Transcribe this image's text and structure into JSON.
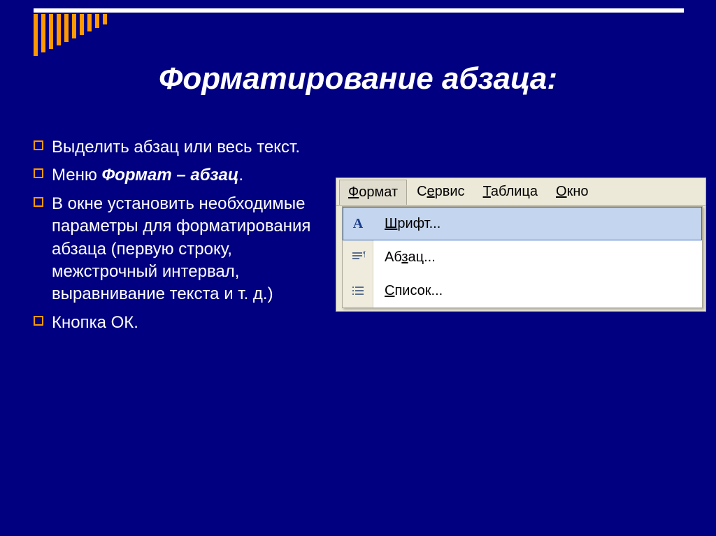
{
  "title": "Форматирование абзаца:",
  "bullets": [
    {
      "pre": "",
      "strong": "",
      "post": "Выделить абзац или весь текст."
    },
    {
      "pre": "Меню ",
      "strong": "Формат – абзац",
      "post": "."
    },
    {
      "pre": "",
      "strong": "",
      "post": "В окне установить необходимые параметры для форматирования абзаца (первую строку, межстрочный интервал, выравнивание текста и т. д.)"
    },
    {
      "pre": "",
      "strong": "",
      "post": "Кнопка ОК."
    }
  ],
  "menubar": {
    "format": "Формат",
    "service": "Сервис",
    "table": "Таблица",
    "window": "Окно"
  },
  "dropdown": {
    "font": "Шрифт...",
    "paragraph": "Абзац...",
    "list": "Список..."
  }
}
